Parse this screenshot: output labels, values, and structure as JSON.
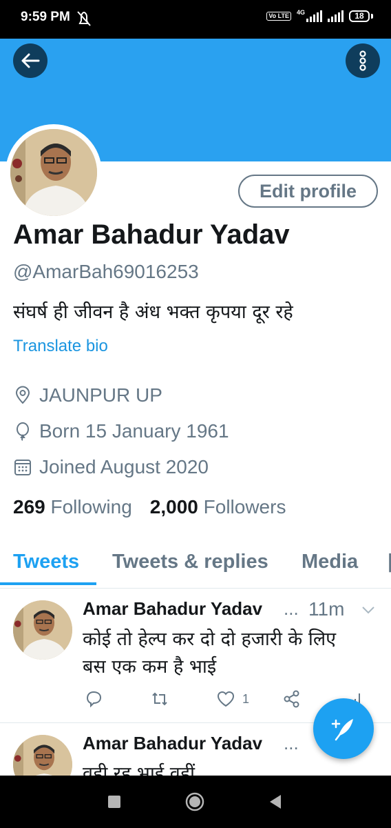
{
  "status_bar": {
    "time": "9:59 PM",
    "volte": "Vo LTE",
    "network": "4G",
    "battery": "18"
  },
  "profile": {
    "name": "Amar Bahadur Yadav",
    "handle": "@AmarBah69016253",
    "bio": "संघर्ष ही जीवन है अंध भक्त कृपया दूर रहे",
    "translate_label": "Translate bio",
    "edit_label": "Edit profile",
    "location": "JAUNPUR UP",
    "born": "Born 15 January 1961",
    "joined": "Joined August 2020",
    "following_count": "269",
    "following_label": "Following",
    "followers_count": "2,000",
    "followers_label": "Followers"
  },
  "tabs": [
    {
      "label": "Tweets",
      "active": true
    },
    {
      "label": "Tweets & replies",
      "active": false
    },
    {
      "label": "Media",
      "active": false
    }
  ],
  "tweets": [
    {
      "name": "Amar Bahadur Yadav",
      "ellipsis": "...",
      "time": "11m",
      "text": "कोई तो हेल्प कर दो दो हजारी के लिए\nबस एक कम है भाई",
      "likes": "1"
    },
    {
      "name": "Amar Bahadur Yadav",
      "ellipsis": "...",
      "text": "वही रह भाई वहीं"
    }
  ],
  "colors": {
    "banner": "#2aa1f0",
    "accent": "#1da1f2",
    "muted": "#657786"
  }
}
